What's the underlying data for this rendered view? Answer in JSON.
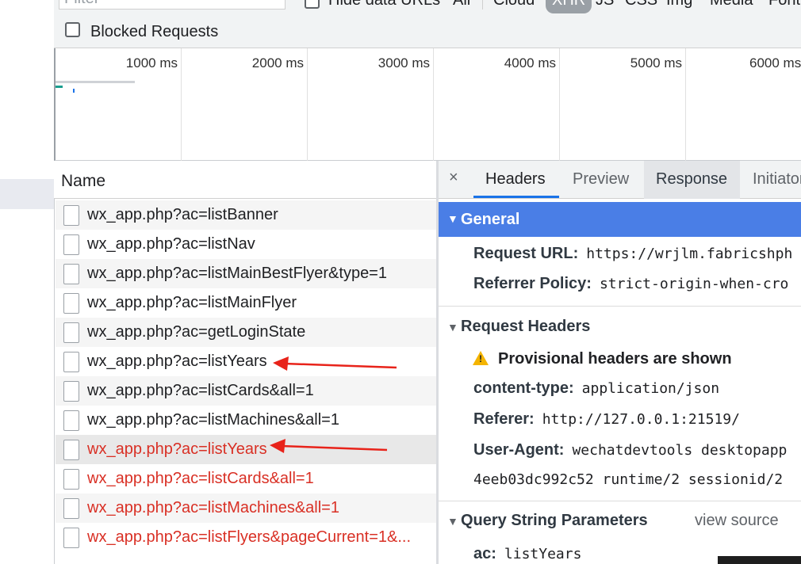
{
  "toolbar": {
    "filter_placeholder": "Filter",
    "hide_data_urls": "Hide data URLs",
    "blocked_requests": "Blocked Requests",
    "type_filters": [
      "All",
      "Cloud",
      "XHR",
      "JS",
      "CSS",
      "Img",
      "Media",
      "Font"
    ],
    "active_type": "XHR"
  },
  "overview": {
    "ticks": [
      "1000 ms",
      "2000 ms",
      "3000 ms",
      "4000 ms",
      "5000 ms",
      "6000 ms"
    ]
  },
  "list": {
    "header": "Name",
    "rows": [
      {
        "name": "wx_app.php?ac=listBanner",
        "failed": false
      },
      {
        "name": "wx_app.php?ac=listNav",
        "failed": false
      },
      {
        "name": "wx_app.php?ac=listMainBestFlyer&type=1",
        "failed": false
      },
      {
        "name": "wx_app.php?ac=listMainFlyer",
        "failed": false
      },
      {
        "name": "wx_app.php?ac=getLoginState",
        "failed": false
      },
      {
        "name": "wx_app.php?ac=listYears",
        "failed": false
      },
      {
        "name": "wx_app.php?ac=listCards&all=1",
        "failed": false
      },
      {
        "name": "wx_app.php?ac=listMachines&all=1",
        "failed": false
      },
      {
        "name": "wx_app.php?ac=listYears",
        "failed": true
      },
      {
        "name": "wx_app.php?ac=listCards&all=1",
        "failed": true
      },
      {
        "name": "wx_app.php?ac=listMachines&all=1",
        "failed": true
      },
      {
        "name": "wx_app.php?ac=listFlyers&pageCurrent=1&...",
        "failed": true
      }
    ]
  },
  "details": {
    "close": "×",
    "tabs": [
      "Headers",
      "Preview",
      "Response",
      "Initiator"
    ],
    "active_tab": "Headers",
    "general": {
      "title": "General",
      "request_url_key": "Request URL:",
      "request_url_val": "https://wrjlm.fabricshph",
      "referrer_policy_key": "Referrer Policy:",
      "referrer_policy_val": "strict-origin-when-cro"
    },
    "request_headers": {
      "title": "Request Headers",
      "provisional": "Provisional headers are shown",
      "content_type_key": "content-type:",
      "content_type_val": "application/json",
      "referer_key": "Referer:",
      "referer_val": "http://127.0.0.1:21519/",
      "user_agent_key": "User-Agent:",
      "user_agent_val": "wechatdevtools desktopapp",
      "user_agent_cont": "4eeb03dc992c52 runtime/2 sessionid/2"
    },
    "query": {
      "title": "Query String Parameters",
      "view_source": "view source",
      "ac_key": "ac:",
      "ac_val": "listYears"
    }
  },
  "colors": {
    "accent": "#1a73e8",
    "general_header": "#4a7ee6",
    "failed_text": "#d93025",
    "annotation_arrow": "#e8231a"
  }
}
